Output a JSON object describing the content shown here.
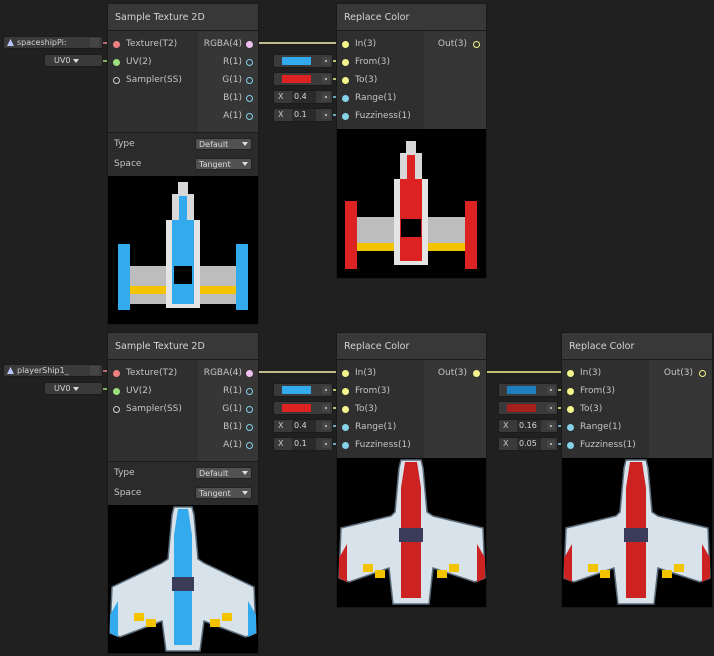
{
  "colors": {
    "background": "#202020",
    "node": "#2f2f2f",
    "texture_wire": "#f08080",
    "uv_wire": "#9de07e",
    "rgba_wire": "#f0c0f0",
    "vec3_wire": "#f5f58c",
    "float_wire": "#84d1e8",
    "cyan": "#33aaee",
    "red": "#dd2222",
    "dark_cyan": "#1e7fbf",
    "dark_red": "#a61f1f"
  },
  "row1": {
    "texture_field": "spaceshipPi:",
    "uv_field": "UV0",
    "sample_node": {
      "title": "Sample Texture 2D",
      "inputs": [
        "Texture(T2)",
        "UV(2)",
        "Sampler(SS)"
      ],
      "outputs": [
        "RGBA(4)",
        "R(1)",
        "G(1)",
        "B(1)",
        "A(1)"
      ],
      "type_label": "Type",
      "type_value": "Default",
      "space_label": "Space",
      "space_value": "Tangent"
    },
    "replace_node": {
      "title": "Replace Color",
      "inputs": [
        "In(3)",
        "From(3)",
        "To(3)",
        "Range(1)",
        "Fuzziness(1)"
      ],
      "output": "Out(3)",
      "from_color": "#33aaee",
      "to_color": "#dd2222",
      "range_axis": "X",
      "range_value": "0.4",
      "fuzziness_axis": "X",
      "fuzziness_value": "0.1"
    }
  },
  "row2": {
    "texture_field": "playerShip1_",
    "uv_field": "UV0",
    "sample_node": {
      "title": "Sample Texture 2D",
      "inputs": [
        "Texture(T2)",
        "UV(2)",
        "Sampler(SS)"
      ],
      "outputs": [
        "RGBA(4)",
        "R(1)",
        "G(1)",
        "B(1)",
        "A(1)"
      ],
      "type_label": "Type",
      "type_value": "Default",
      "space_label": "Space",
      "space_value": "Tangent"
    },
    "replace_node_1": {
      "title": "Replace Color",
      "inputs": [
        "In(3)",
        "From(3)",
        "To(3)",
        "Range(1)",
        "Fuzziness(1)"
      ],
      "output": "Out(3)",
      "from_color": "#33aaee",
      "to_color": "#dd2222",
      "range_axis": "X",
      "range_value": "0.4",
      "fuzziness_axis": "X",
      "fuzziness_value": "0.1"
    },
    "replace_node_2": {
      "title": "Replace Color",
      "inputs": [
        "In(3)",
        "From(3)",
        "To(3)",
        "Range(1)",
        "Fuzziness(1)"
      ],
      "output": "Out(3)",
      "from_color": "#1e7fbf",
      "to_color": "#a61f1f",
      "range_axis": "X",
      "range_value": "0.16",
      "fuzziness_axis": "X",
      "fuzziness_value": "0.05"
    }
  }
}
